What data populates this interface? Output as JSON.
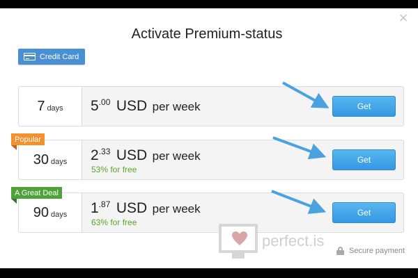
{
  "modal": {
    "title": "Activate Premium-status",
    "close_icon": "×"
  },
  "payment_tab": {
    "label": "Credit Card",
    "icon": "credit-card-icon"
  },
  "plans": [
    {
      "days": "7",
      "days_unit": "days",
      "price_int": "5",
      "price_dec": ".00",
      "currency": "USD",
      "per": "per week",
      "free_text": "",
      "button": "Get"
    },
    {
      "badge": "Popular",
      "days": "30",
      "days_unit": "days",
      "price_int": "2",
      "price_dec": ".33",
      "currency": "USD",
      "per": "per week",
      "free_text": "53% for free",
      "button": "Get"
    },
    {
      "badge": "A Great Deal",
      "days": "90",
      "days_unit": "days",
      "price_int": "1",
      "price_dec": ".87",
      "currency": "USD",
      "per": "per week",
      "free_text": "63% for free",
      "button": "Get"
    }
  ],
  "watermark": {
    "text": "perfect.is"
  },
  "footer": {
    "secure_label": "Secure payment",
    "icon": "lock-icon"
  },
  "colors": {
    "accent_blue": "#4a8fd2",
    "button_blue": "#3498e2",
    "free_green": "#5aa52c",
    "popular_orange": "#f3912d",
    "deal_green": "#4fa23a",
    "arrow_blue": "#4aa3df"
  }
}
